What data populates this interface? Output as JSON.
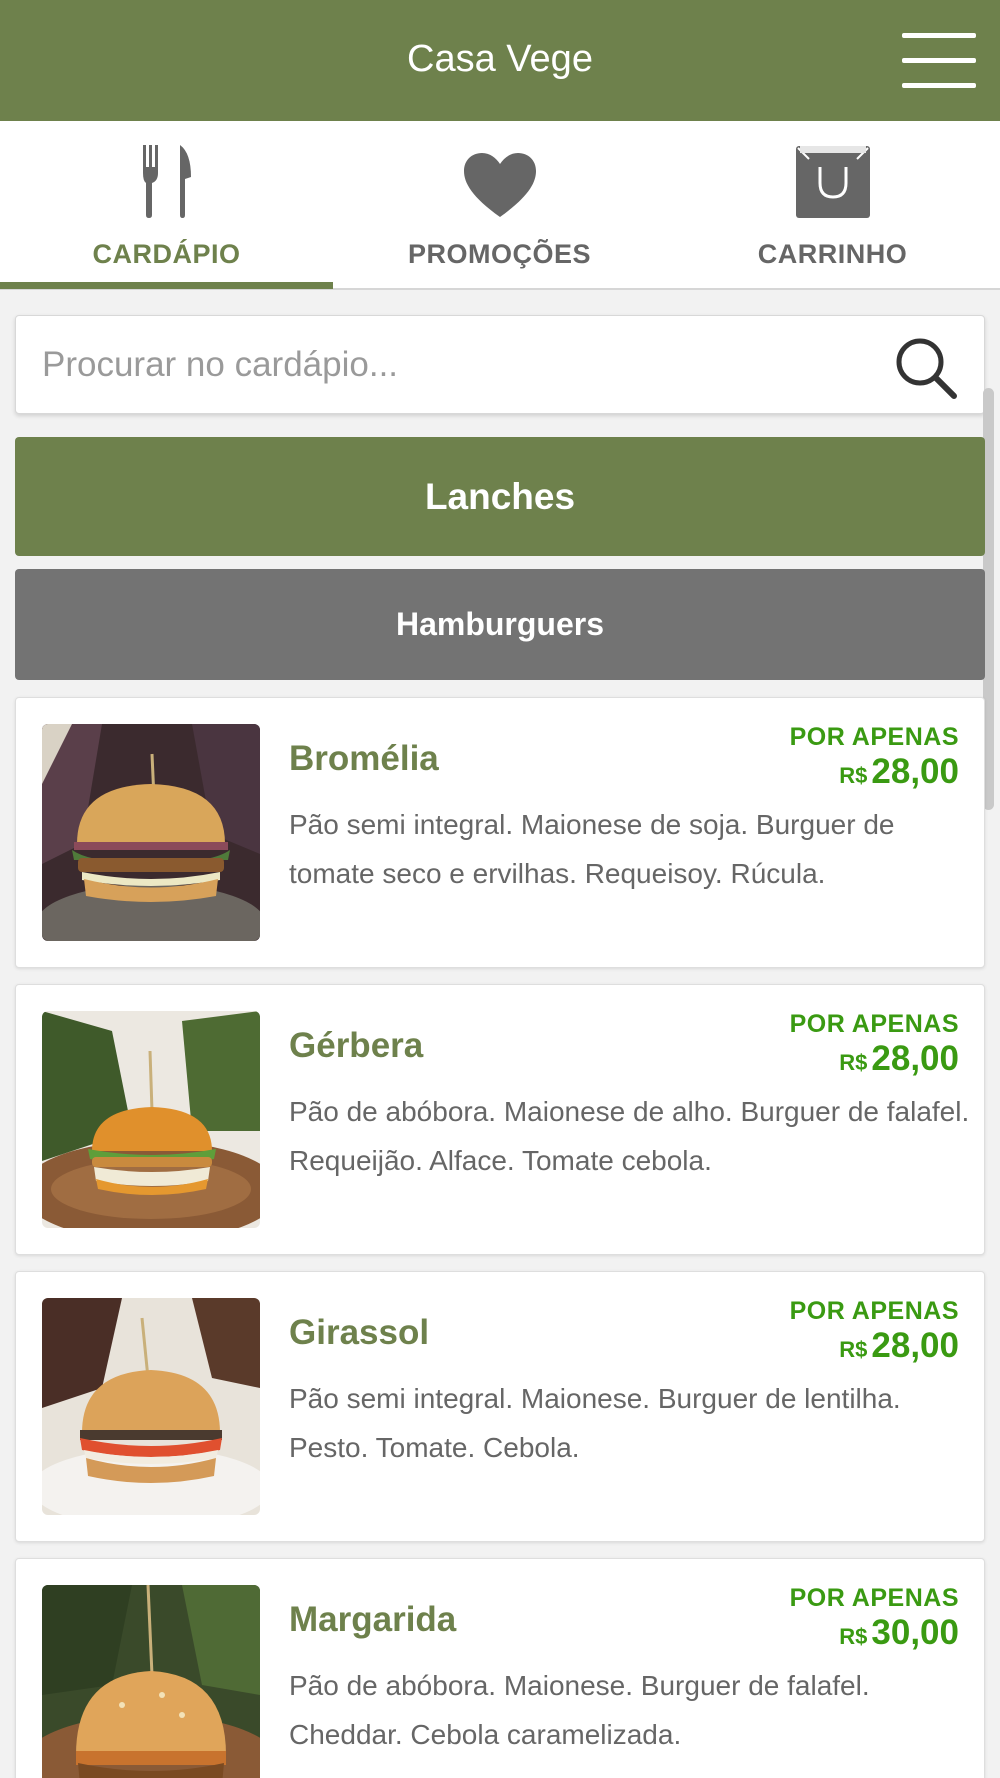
{
  "app": {
    "title": "Casa Vege"
  },
  "tabs": [
    {
      "label": "CARDÁPIO",
      "icon": "fork-knife-icon",
      "active": true
    },
    {
      "label": "PROMOÇÕES",
      "icon": "heart-icon",
      "active": false
    },
    {
      "label": "CARRINHO",
      "icon": "shopping-bag-icon",
      "active": false
    }
  ],
  "search": {
    "placeholder": "Procurar no cardápio..."
  },
  "menu": {
    "category": "Lanches",
    "subcategory": "Hamburguers",
    "items": [
      {
        "name": "Bromélia",
        "price_caption": "POR APENAS",
        "currency": "R$",
        "price": "28,00",
        "description": "Pão semi integral. Maionese de soja. Burguer de tomate seco e ervilhas. Requeisoy. Rúcula."
      },
      {
        "name": "Gérbera",
        "price_caption": "POR APENAS",
        "currency": "R$",
        "price": "28,00",
        "description": "Pão de abóbora. Maionese de alho. Burguer de falafel. Requeijão. Alface. Tomate cebola."
      },
      {
        "name": "Girassol",
        "price_caption": "POR APENAS",
        "currency": "R$",
        "price": "28,00",
        "description": "Pão semi integral. Maionese. Burguer de lentilha. Pesto. Tomate. Cebola."
      },
      {
        "name": "Margarida",
        "price_caption": "POR APENAS",
        "currency": "R$",
        "price": "30,00",
        "description": "Pão de abóbora. Maionese. Burguer de falafel. Cheddar. Cebola caramelizada."
      }
    ]
  },
  "colors": {
    "brand": "#6e814c",
    "price": "#3a9a12",
    "subcategory": "#737373",
    "tab_inactive": "#666666"
  }
}
